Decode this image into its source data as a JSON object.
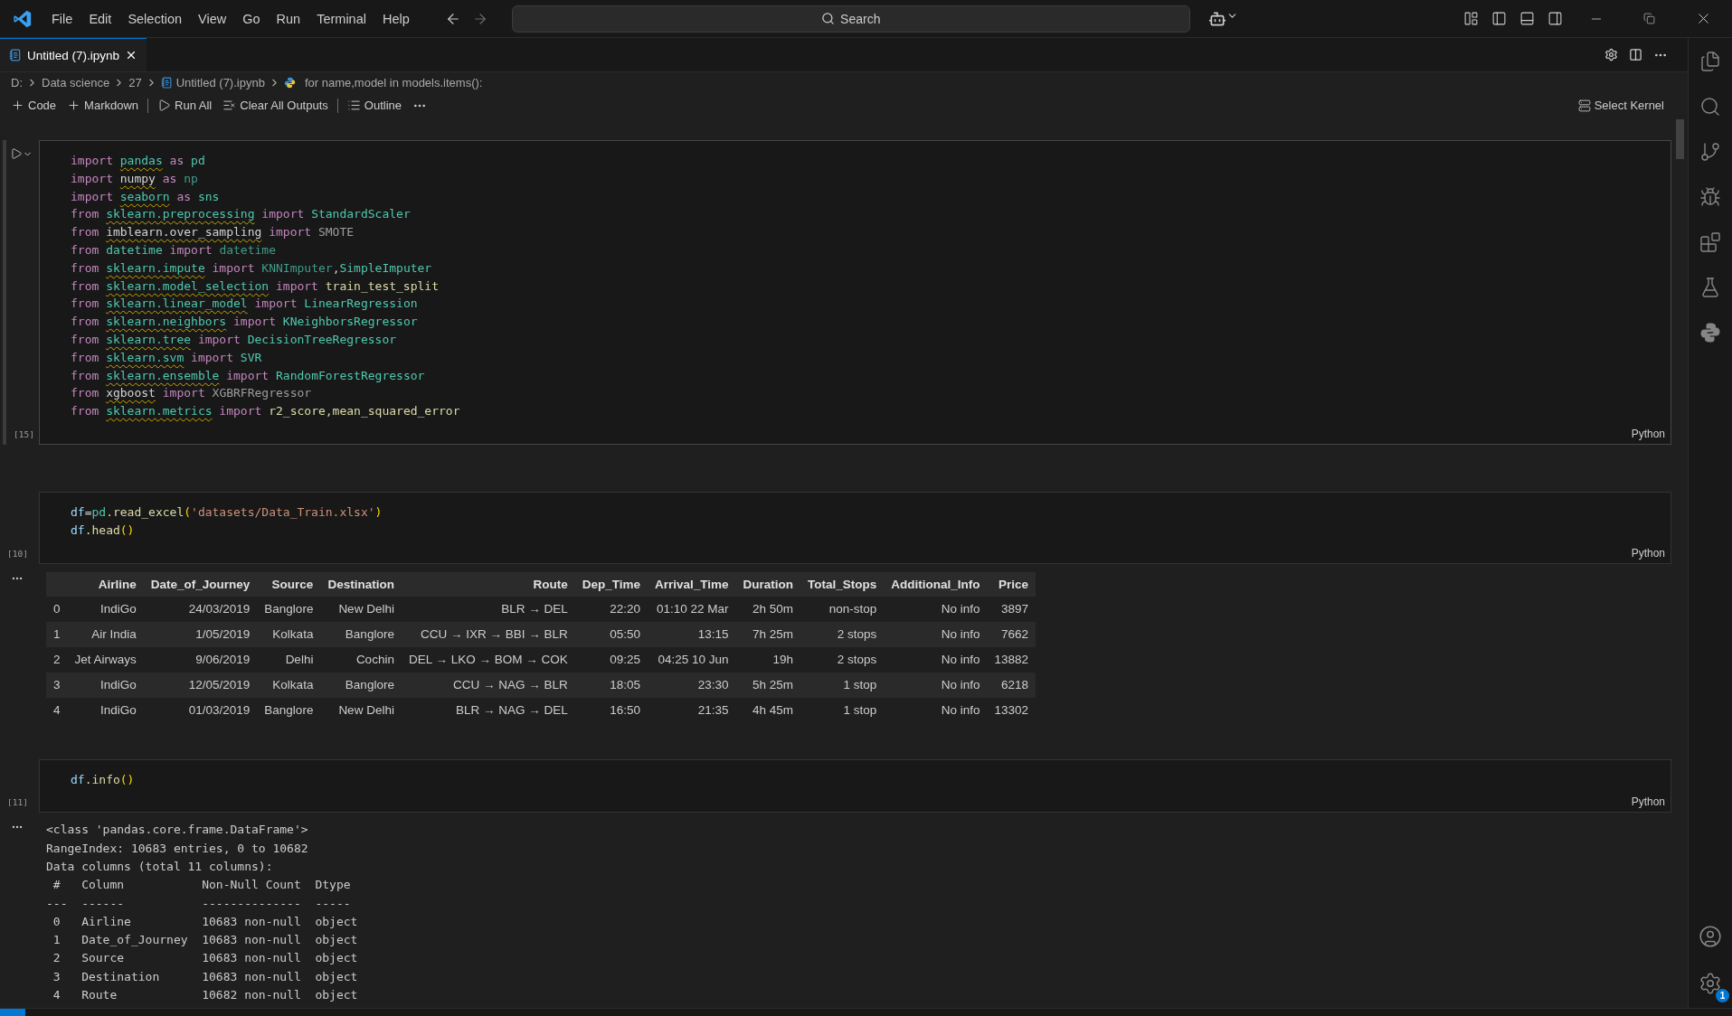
{
  "title_bar": {
    "menu": [
      "File",
      "Edit",
      "Selection",
      "View",
      "Go",
      "Run",
      "Terminal",
      "Help"
    ],
    "search": {
      "placeholder": "Search"
    }
  },
  "editor_tabs": [
    {
      "label": "Untitled (7).ipynb",
      "selected": true
    }
  ],
  "breadcrumbs": [
    {
      "label": "D:",
      "kind": "folder"
    },
    {
      "label": "Data science",
      "kind": "folder"
    },
    {
      "label": "27",
      "kind": "folder"
    },
    {
      "label": "Untitled (7).ipynb",
      "kind": "notebook"
    },
    {
      "label": "for name,model in models.items():",
      "kind": "python"
    }
  ],
  "toolbar": [
    {
      "label": "Code",
      "kind": "add"
    },
    {
      "label": "Markdown",
      "kind": "add"
    },
    {
      "kind": "separator"
    },
    {
      "label": "Run All",
      "kind": "run"
    },
    {
      "label": "Clear All Outputs",
      "kind": "clear"
    },
    {
      "kind": "separator"
    },
    {
      "label": "Outline",
      "kind": "outline"
    },
    {
      "kind": "more"
    }
  ],
  "kernel": {
    "label": "Select Kernel"
  },
  "cells": [
    {
      "selected": true,
      "count": "[15]",
      "language": "Python",
      "lines": [
        [
          {
            "text": "import ",
            "kind": "keyword"
          },
          {
            "text": "pandas",
            "kind": "module"
          },
          {
            "text": " as ",
            "kind": "keyword"
          },
          {
            "text": "pd",
            "kind": "class"
          }
        ],
        [
          {
            "text": "import ",
            "kind": "keyword"
          },
          {
            "text": "numpy",
            "kind": "unresolved"
          },
          {
            "text": " as ",
            "kind": "keyword"
          },
          {
            "text": "np",
            "kind": "dim"
          }
        ],
        [
          {
            "text": "import ",
            "kind": "keyword"
          },
          {
            "text": "seaborn",
            "kind": "module"
          },
          {
            "text": " as ",
            "kind": "keyword"
          },
          {
            "text": "sns",
            "kind": "class"
          }
        ],
        [
          {
            "text": "from ",
            "kind": "keyword"
          },
          {
            "text": "sklearn.preprocessing",
            "kind": "module"
          },
          {
            "text": " import ",
            "kind": "keyword"
          },
          {
            "text": "StandardScaler",
            "kind": "class"
          }
        ],
        [
          {
            "text": "from ",
            "kind": "keyword"
          },
          {
            "text": "imblearn.over_sampling",
            "kind": "unresolved"
          },
          {
            "text": " import ",
            "kind": "keyword"
          },
          {
            "text": "SMOTE",
            "kind": "grey"
          }
        ],
        [
          {
            "text": "from ",
            "kind": "keyword"
          },
          {
            "text": "datetime",
            "kind": "class"
          },
          {
            "text": " import ",
            "kind": "keyword"
          },
          {
            "text": "datetime",
            "kind": "dim"
          }
        ],
        [
          {
            "text": "from ",
            "kind": "keyword"
          },
          {
            "text": "sklearn.impute",
            "kind": "module"
          },
          {
            "text": " import ",
            "kind": "keyword"
          },
          {
            "text": "KNNImputer",
            "kind": "dim"
          },
          {
            "text": ",",
            "kind": "plain"
          },
          {
            "text": "SimpleImputer",
            "kind": "class"
          }
        ],
        [
          {
            "text": "from ",
            "kind": "keyword"
          },
          {
            "text": "sklearn.model_selection",
            "kind": "module"
          },
          {
            "text": " import ",
            "kind": "keyword"
          },
          {
            "text": "train_test_split",
            "kind": "function"
          }
        ],
        [
          {
            "text": "from ",
            "kind": "keyword"
          },
          {
            "text": "sklearn.linear_model",
            "kind": "module"
          },
          {
            "text": " import ",
            "kind": "keyword"
          },
          {
            "text": "LinearRegression",
            "kind": "class"
          }
        ],
        [
          {
            "text": "from ",
            "kind": "keyword"
          },
          {
            "text": "sklearn.neighbors",
            "kind": "module"
          },
          {
            "text": " import ",
            "kind": "keyword"
          },
          {
            "text": "KNeighborsRegressor",
            "kind": "class"
          }
        ],
        [
          {
            "text": "from ",
            "kind": "keyword"
          },
          {
            "text": "sklearn.tree",
            "kind": "module"
          },
          {
            "text": " import ",
            "kind": "keyword"
          },
          {
            "text": "DecisionTreeRegressor",
            "kind": "class"
          }
        ],
        [
          {
            "text": "from ",
            "kind": "keyword"
          },
          {
            "text": "sklearn.svm",
            "kind": "module"
          },
          {
            "text": " import ",
            "kind": "keyword"
          },
          {
            "text": "SVR",
            "kind": "class"
          }
        ],
        [
          {
            "text": "from ",
            "kind": "keyword"
          },
          {
            "text": "sklearn.ensemble",
            "kind": "module"
          },
          {
            "text": " import ",
            "kind": "keyword"
          },
          {
            "text": "RandomForestRegressor",
            "kind": "class"
          }
        ],
        [
          {
            "text": "from ",
            "kind": "keyword"
          },
          {
            "text": "xgboost",
            "kind": "unresolved"
          },
          {
            "text": " import ",
            "kind": "keyword"
          },
          {
            "text": "XGBRFRegressor",
            "kind": "grey"
          }
        ],
        [
          {
            "text": "from ",
            "kind": "keyword"
          },
          {
            "text": "sklearn.metrics",
            "kind": "module"
          },
          {
            "text": " import ",
            "kind": "keyword"
          },
          {
            "text": "r2_score,mean_squared_error",
            "kind": "function"
          }
        ]
      ]
    },
    {
      "selected": false,
      "count": "[10]",
      "language": "Python",
      "lines": [
        [
          {
            "text": "df",
            "kind": "variable"
          },
          {
            "text": "=",
            "kind": "plain"
          },
          {
            "text": "pd",
            "kind": "class"
          },
          {
            "text": ".read_excel",
            "kind": "function"
          },
          {
            "text": "(",
            "kind": "bracket"
          },
          {
            "text": "'datasets/Data_Train.xlsx'",
            "kind": "string"
          },
          {
            "text": ")",
            "kind": "bracket"
          }
        ],
        [
          {
            "text": "df",
            "kind": "variable"
          },
          {
            "text": ".head",
            "kind": "function"
          },
          {
            "text": "()",
            "kind": "bracket"
          }
        ]
      ],
      "output": {
        "kind": "table",
        "columns": [
          "Airline",
          "Date_of_Journey",
          "Source",
          "Destination",
          "Route",
          "Dep_Time",
          "Arrival_Time",
          "Duration",
          "Total_Stops",
          "Additional_Info",
          "Price"
        ],
        "rows": [
          {
            "index": "0",
            "cells": [
              "IndiGo",
              "24/03/2019",
              "Banglore",
              "New Delhi",
              "BLR → DEL",
              "22:20",
              "01:10 22 Mar",
              "2h 50m",
              "non-stop",
              "No info",
              "3897"
            ]
          },
          {
            "index": "1",
            "cells": [
              "Air India",
              "1/05/2019",
              "Kolkata",
              "Banglore",
              "CCU → IXR → BBI → BLR",
              "05:50",
              "13:15",
              "7h 25m",
              "2 stops",
              "No info",
              "7662"
            ]
          },
          {
            "index": "2",
            "cells": [
              "Jet Airways",
              "9/06/2019",
              "Delhi",
              "Cochin",
              "DEL → LKO → BOM → COK",
              "09:25",
              "04:25 10 Jun",
              "19h",
              "2 stops",
              "No info",
              "13882"
            ]
          },
          {
            "index": "3",
            "cells": [
              "IndiGo",
              "12/05/2019",
              "Kolkata",
              "Banglore",
              "CCU → NAG → BLR",
              "18:05",
              "23:30",
              "5h 25m",
              "1 stop",
              "No info",
              "6218"
            ]
          },
          {
            "index": "4",
            "cells": [
              "IndiGo",
              "01/03/2019",
              "Banglore",
              "New Delhi",
              "BLR → NAG → DEL",
              "16:50",
              "21:35",
              "4h 45m",
              "1 stop",
              "No info",
              "13302"
            ]
          }
        ]
      }
    },
    {
      "selected": false,
      "count": "[11]",
      "language": "Python",
      "lines": [
        [
          {
            "text": "df",
            "kind": "variable"
          },
          {
            "text": ".info",
            "kind": "function"
          },
          {
            "text": "()",
            "kind": "bracket"
          }
        ]
      ],
      "output": {
        "kind": "text",
        "lines": [
          "<class 'pandas.core.frame.DataFrame'>",
          "RangeIndex: 10683 entries, 0 to 10682",
          "Data columns (total 11 columns):",
          " #   Column           Non-Null Count  Dtype ",
          "---  ------           --------------  ----- ",
          " 0   Airline          10683 non-null  object",
          " 1   Date_of_Journey  10683 non-null  object",
          " 2   Source           10683 non-null  object",
          " 3   Destination      10683 non-null  object",
          " 4   Route            10682 non-null  object"
        ]
      }
    }
  ],
  "activity_bar": {
    "settings_badge": "1"
  }
}
